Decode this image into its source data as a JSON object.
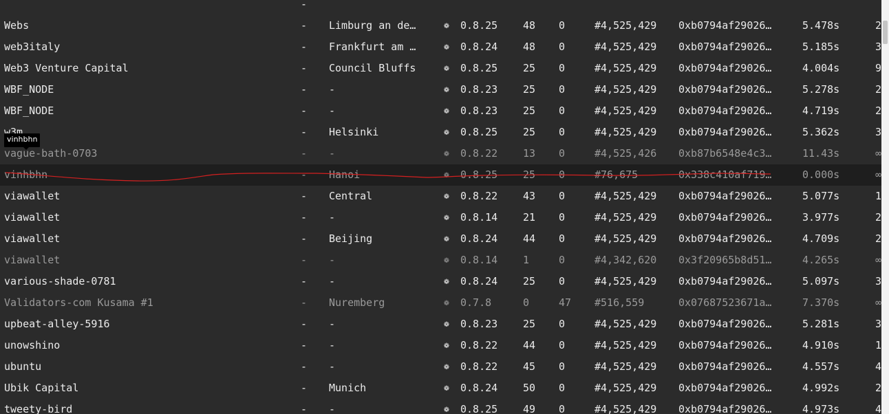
{
  "icon": "cpu-icon",
  "icon_glyph": "❁",
  "tooltip": "vinhbhn",
  "rows": [
    {
      "name": "",
      "impl": "-",
      "city": "",
      "ver": "",
      "peers": "",
      "txs": "",
      "block": "",
      "hash": "",
      "prop": "",
      "last": "",
      "stale": false,
      "show_icon": false
    },
    {
      "name": "Webs",
      "impl": "-",
      "city": "Limburg an de…",
      "ver": "0.8.25",
      "peers": "48",
      "txs": "0",
      "block": "#4,525,429",
      "hash": "0xb0794af29026…",
      "prop": "5.478s",
      "last": "2",
      "stale": false,
      "show_icon": true
    },
    {
      "name": "web3italy",
      "impl": "-",
      "city": "Frankfurt am …",
      "ver": "0.8.24",
      "peers": "48",
      "txs": "0",
      "block": "#4,525,429",
      "hash": "0xb0794af29026…",
      "prop": "5.185s",
      "last": "3",
      "stale": false,
      "show_icon": true
    },
    {
      "name": "Web3 Venture Capital",
      "impl": "-",
      "city": "Council Bluffs",
      "ver": "0.8.25",
      "peers": "25",
      "txs": "0",
      "block": "#4,525,429",
      "hash": "0xb0794af29026…",
      "prop": "4.004s",
      "last": "9",
      "stale": false,
      "show_icon": true
    },
    {
      "name": "WBF_NODE",
      "impl": "-",
      "city": "-",
      "ver": "0.8.23",
      "peers": "25",
      "txs": "0",
      "block": "#4,525,429",
      "hash": "0xb0794af29026…",
      "prop": "5.278s",
      "last": "2",
      "stale": false,
      "show_icon": true
    },
    {
      "name": "WBF_NODE",
      "impl": "-",
      "city": "-",
      "ver": "0.8.23",
      "peers": "25",
      "txs": "0",
      "block": "#4,525,429",
      "hash": "0xb0794af29026…",
      "prop": "4.719s",
      "last": "2",
      "stale": false,
      "show_icon": true
    },
    {
      "name": "w3m",
      "impl": "-",
      "city": "Helsinki",
      "ver": "0.8.25",
      "peers": "25",
      "txs": "0",
      "block": "#4,525,429",
      "hash": "0xb0794af29026…",
      "prop": "5.362s",
      "last": "3",
      "stale": false,
      "show_icon": true
    },
    {
      "name": "vague-bath-0703",
      "impl": "-",
      "city": "-",
      "ver": "0.8.22",
      "peers": "13",
      "txs": "0",
      "block": "#4,525,426",
      "hash": "0xb87b6548e4c3…",
      "prop": "11.43s",
      "last": "∞",
      "stale": true,
      "show_icon": true
    },
    {
      "name": "vinhbhn",
      "impl": "-",
      "city": "Hanoi",
      "ver": "0.8.25",
      "peers": "25",
      "txs": "0",
      "block": "#76,675",
      "hash": "0x338c410af719…",
      "prop": "0.000s",
      "last": "∞",
      "stale": true,
      "show_icon": true,
      "highlight": true
    },
    {
      "name": "viawallet",
      "impl": "-",
      "city": "Central",
      "ver": "0.8.22",
      "peers": "43",
      "txs": "0",
      "block": "#4,525,429",
      "hash": "0xb0794af29026…",
      "prop": "5.077s",
      "last": "1",
      "stale": false,
      "show_icon": true
    },
    {
      "name": "viawallet",
      "impl": "-",
      "city": "-",
      "ver": "0.8.14",
      "peers": "21",
      "txs": "0",
      "block": "#4,525,429",
      "hash": "0xb0794af29026…",
      "prop": "3.977s",
      "last": "2",
      "stale": false,
      "show_icon": true
    },
    {
      "name": "viawallet",
      "impl": "-",
      "city": "Beijing",
      "ver": "0.8.24",
      "peers": "44",
      "txs": "0",
      "block": "#4,525,429",
      "hash": "0xb0794af29026…",
      "prop": "4.709s",
      "last": "2",
      "stale": false,
      "show_icon": true
    },
    {
      "name": "viawallet",
      "impl": "-",
      "city": "-",
      "ver": "0.8.14",
      "peers": "1",
      "txs": "0",
      "block": "#4,342,620",
      "hash": "0x3f20965b8d51…",
      "prop": "4.265s",
      "last": "∞",
      "stale": true,
      "show_icon": true
    },
    {
      "name": "various-shade-0781",
      "impl": "-",
      "city": "-",
      "ver": "0.8.24",
      "peers": "25",
      "txs": "0",
      "block": "#4,525,429",
      "hash": "0xb0794af29026…",
      "prop": "5.097s",
      "last": "3",
      "stale": false,
      "show_icon": true
    },
    {
      "name": "Validators-com Kusama #1",
      "impl": "-",
      "city": "Nuremberg",
      "ver": "0.7.8",
      "peers": "0",
      "txs": "47",
      "block": "#516,559",
      "hash": "0x07687523671a…",
      "prop": "7.370s",
      "last": "∞",
      "stale": true,
      "show_icon": true
    },
    {
      "name": "upbeat-alley-5916",
      "impl": "-",
      "city": "-",
      "ver": "0.8.23",
      "peers": "25",
      "txs": "0",
      "block": "#4,525,429",
      "hash": "0xb0794af29026…",
      "prop": "5.281s",
      "last": "3",
      "stale": false,
      "show_icon": true
    },
    {
      "name": "unowshino",
      "impl": "-",
      "city": "-",
      "ver": "0.8.22",
      "peers": "44",
      "txs": "0",
      "block": "#4,525,429",
      "hash": "0xb0794af29026…",
      "prop": "4.910s",
      "last": "1",
      "stale": false,
      "show_icon": true
    },
    {
      "name": "ubuntu",
      "impl": "-",
      "city": "-",
      "ver": "0.8.22",
      "peers": "45",
      "txs": "0",
      "block": "#4,525,429",
      "hash": "0xb0794af29026…",
      "prop": "4.557s",
      "last": "4",
      "stale": false,
      "show_icon": true
    },
    {
      "name": "Ubik Capital",
      "impl": "-",
      "city": "Munich",
      "ver": "0.8.24",
      "peers": "50",
      "txs": "0",
      "block": "#4,525,429",
      "hash": "0xb0794af29026…",
      "prop": "4.992s",
      "last": "2",
      "stale": false,
      "show_icon": true
    },
    {
      "name": "tweety-bird",
      "impl": "-",
      "city": "-",
      "ver": "0.8.25",
      "peers": "49",
      "txs": "0",
      "block": "#4,525,429",
      "hash": "0xb0794af29026…",
      "prop": "4.973s",
      "last": "4",
      "stale": false,
      "show_icon": true
    }
  ]
}
